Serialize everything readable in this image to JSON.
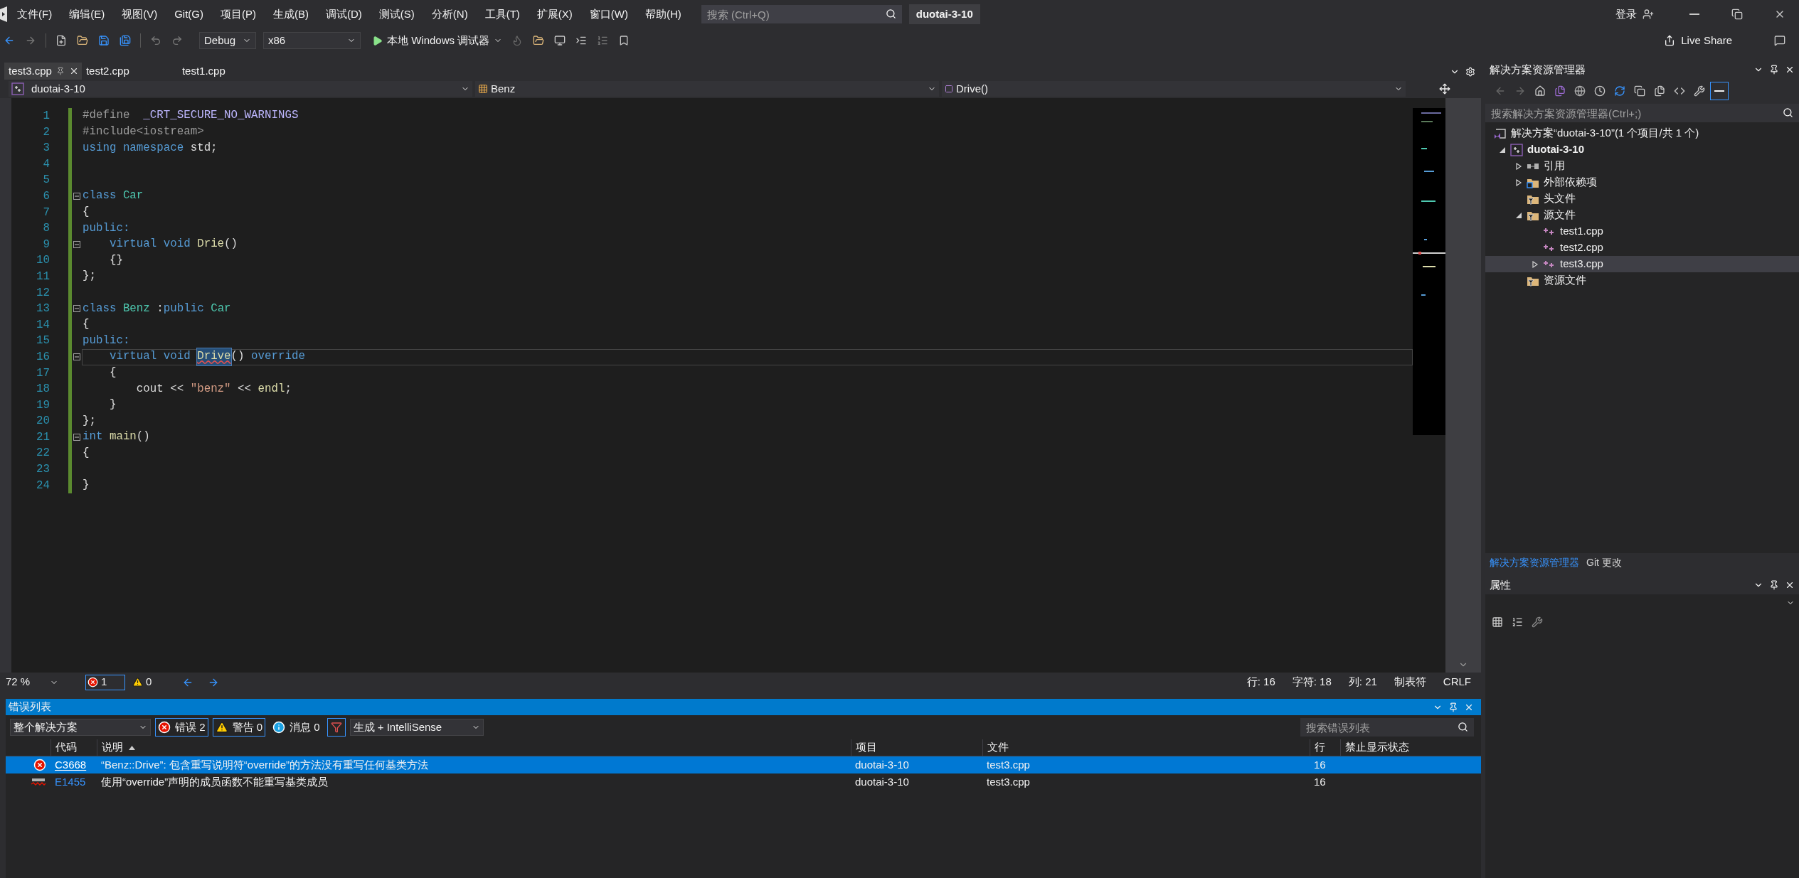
{
  "menu_bar": {
    "items": [
      "文件(F)",
      "编辑(E)",
      "视图(V)",
      "Git(G)",
      "项目(P)",
      "生成(B)",
      "调试(D)",
      "测试(S)",
      "分析(N)",
      "工具(T)",
      "扩展(X)",
      "窗口(W)",
      "帮助(H)"
    ],
    "search": {
      "placeholder": "搜索 (Ctrl+Q)"
    },
    "solution_name": "duotai-3-10",
    "sign_in": "登录"
  },
  "toolbar": {
    "configuration": "Debug",
    "platform": "x86",
    "run_button": "本地 Windows 调试器",
    "live_share": "Live Share"
  },
  "editor_tabs": [
    {
      "label": "test3.cpp",
      "selected": true
    },
    {
      "label": "test2.cpp",
      "selected": false
    },
    {
      "label": "test1.cpp",
      "selected": false
    }
  ],
  "navigation_bar": {
    "project": "duotai-3-10",
    "scope": "Benz",
    "member": "Drive()"
  },
  "code_lines": [
    {
      "number": "1",
      "foldable": false,
      "current": false,
      "tokens": [
        {
          "text": "#define  ",
          "kind": "preproc"
        },
        {
          "text": "_CRT_SECURE_NO_WARNINGS",
          "kind": "macro"
        }
      ]
    },
    {
      "number": "2",
      "foldable": false,
      "current": false,
      "tokens": [
        {
          "text": "#include<iostream>",
          "kind": "preproc"
        }
      ]
    },
    {
      "number": "3",
      "foldable": false,
      "current": false,
      "tokens": [
        {
          "text": "using",
          "kind": "keyword"
        },
        {
          "text": " namespace",
          "kind": "keyword"
        },
        {
          "text": " std;",
          "kind": "plain"
        }
      ]
    },
    {
      "number": "4",
      "foldable": false,
      "current": false
    },
    {
      "number": "5",
      "foldable": false,
      "current": false
    },
    {
      "number": "6",
      "foldable": true,
      "current": false,
      "tokens": [
        {
          "text": "class",
          "kind": "keyword"
        },
        {
          "text": " Car",
          "kind": "type"
        }
      ]
    },
    {
      "number": "7",
      "foldable": false,
      "current": false,
      "tokens": [
        {
          "text": "{",
          "kind": "plain"
        }
      ]
    },
    {
      "number": "8",
      "foldable": false,
      "current": false,
      "tokens": [
        {
          "text": "public:",
          "kind": "keyword"
        }
      ]
    },
    {
      "number": "9",
      "foldable": true,
      "current": false,
      "tokens": [
        {
          "text": "    virtual",
          "kind": "keyword"
        },
        {
          "text": " void",
          "kind": "keyword"
        },
        {
          "text": " Drie",
          "kind": "func"
        },
        {
          "text": "()",
          "kind": "plain"
        }
      ]
    },
    {
      "number": "10",
      "foldable": false,
      "current": false,
      "tokens": [
        {
          "text": "    {}",
          "kind": "plain"
        }
      ]
    },
    {
      "number": "11",
      "foldable": false,
      "current": false,
      "tokens": [
        {
          "text": "};",
          "kind": "plain"
        }
      ]
    },
    {
      "number": "12",
      "foldable": false,
      "current": false
    },
    {
      "number": "13",
      "foldable": true,
      "current": false,
      "tokens": [
        {
          "text": "class",
          "kind": "keyword"
        },
        {
          "text": " Benz",
          "kind": "type"
        },
        {
          "text": " :",
          "kind": "plain"
        },
        {
          "text": "public",
          "kind": "keyword"
        },
        {
          "text": " Car",
          "kind": "type"
        }
      ]
    },
    {
      "number": "14",
      "foldable": false,
      "current": false,
      "tokens": [
        {
          "text": "{",
          "kind": "plain"
        }
      ]
    },
    {
      "number": "15",
      "foldable": false,
      "current": false,
      "tokens": [
        {
          "text": "public:",
          "kind": "keyword"
        }
      ]
    },
    {
      "number": "16",
      "foldable": true,
      "current": true,
      "tokens": [
        {
          "text": "    virtual",
          "kind": "keyword"
        },
        {
          "text": " void ",
          "kind": "keyword"
        },
        {
          "text": "Drive",
          "kind": "highlight"
        },
        {
          "text": "() ",
          "kind": "plain"
        },
        {
          "text": "override",
          "kind": "keyword"
        }
      ]
    },
    {
      "number": "17",
      "foldable": false,
      "current": false,
      "tokens": [
        {
          "text": "    {",
          "kind": "plain"
        }
      ]
    },
    {
      "number": "18",
      "foldable": false,
      "current": false,
      "tokens": [
        {
          "text": "        cout << ",
          "kind": "plain"
        },
        {
          "text": "\"benz\"",
          "kind": "string"
        },
        {
          "text": " << ",
          "kind": "plain"
        },
        {
          "text": "endl",
          "kind": "func"
        },
        {
          "text": ";",
          "kind": "plain"
        }
      ]
    },
    {
      "number": "19",
      "foldable": false,
      "current": false,
      "tokens": [
        {
          "text": "    }",
          "kind": "plain"
        }
      ]
    },
    {
      "number": "20",
      "foldable": false,
      "current": false,
      "tokens": [
        {
          "text": "};",
          "kind": "plain"
        }
      ]
    },
    {
      "number": "21",
      "foldable": true,
      "current": false,
      "tokens": [
        {
          "text": "int",
          "kind": "keyword"
        },
        {
          "text": " main",
          "kind": "func"
        },
        {
          "text": "()",
          "kind": "plain"
        }
      ]
    },
    {
      "number": "22",
      "foldable": false,
      "current": false,
      "tokens": [
        {
          "text": "{",
          "kind": "plain"
        }
      ]
    },
    {
      "number": "23",
      "foldable": false,
      "current": false
    },
    {
      "number": "24",
      "foldable": false,
      "current": false,
      "tokens": [
        {
          "text": "}",
          "kind": "plain"
        }
      ]
    }
  ],
  "status_bar": {
    "zoom": "72 %",
    "errors": "1",
    "warnings": "0",
    "line": "行: 16",
    "char": "字符: 18",
    "column": "列: 21",
    "indent": "制表符",
    "line_ending": "CRLF"
  },
  "error_list": {
    "title": "错误列表",
    "scope": "整个解决方案",
    "filters": [
      {
        "kind": "error",
        "label": "错误 2",
        "selected": true
      },
      {
        "kind": "warning",
        "label": "警告 0",
        "selected": true
      },
      {
        "kind": "message",
        "label": "消息 0",
        "selected": false
      }
    ],
    "source": "生成 + IntelliSense",
    "search": {
      "placeholder": "搜索错误列表"
    },
    "columns": [
      "代码",
      "说明",
      "项目",
      "文件",
      "行",
      "禁止显示状态"
    ],
    "rows": [
      {
        "kind": "build_error",
        "code": "C3668",
        "description": "“Benz::Drive”: 包含重写说明符“override”的方法没有重写任何基类方法",
        "project": "duotai-3-10",
        "file": "test3.cpp",
        "line": "16",
        "selected": true
      },
      {
        "kind": "intellisense",
        "code": "E1455",
        "description": "使用“override”声明的成员函数不能重写基类成员",
        "project": "duotai-3-10",
        "file": "test3.cpp",
        "line": "16",
        "selected": false
      }
    ]
  },
  "solution_explorer": {
    "title": "解决方案资源管理器",
    "search": {
      "placeholder": "搜索解决方案资源管理器(Ctrl+;)"
    },
    "tree": [
      {
        "label": "解决方案“duotai-3-10”(1 个项目/共 1 个)",
        "kind": "solution",
        "selected": false,
        "children": [
          {
            "label": "duotai-3-10",
            "kind": "project",
            "expanded": true,
            "selected": false,
            "children": [
              {
                "label": "引用",
                "kind": "references",
                "expanded": false,
                "selected": false
              },
              {
                "label": "外部依赖项",
                "kind": "external",
                "expanded": false,
                "selected": false
              },
              {
                "label": "头文件",
                "kind": "filter",
                "selected": false
              },
              {
                "label": "源文件",
                "kind": "filter",
                "expanded": true,
                "selected": false,
                "children": [
                  {
                    "label": "test1.cpp",
                    "kind": "cpp",
                    "selected": false
                  },
                  {
                    "label": "test2.cpp",
                    "kind": "cpp",
                    "selected": false
                  },
                  {
                    "label": "test3.cpp",
                    "kind": "cpp",
                    "expanded": false,
                    "selected": true
                  }
                ]
              },
              {
                "label": "资源文件",
                "kind": "filter",
                "selected": false
              }
            ]
          }
        ]
      }
    ]
  },
  "side_tabs": [
    {
      "label": "解决方案资源管理器",
      "selected": true
    },
    {
      "label": "Git 更改",
      "selected": false
    }
  ],
  "properties": {
    "title": "属性"
  }
}
